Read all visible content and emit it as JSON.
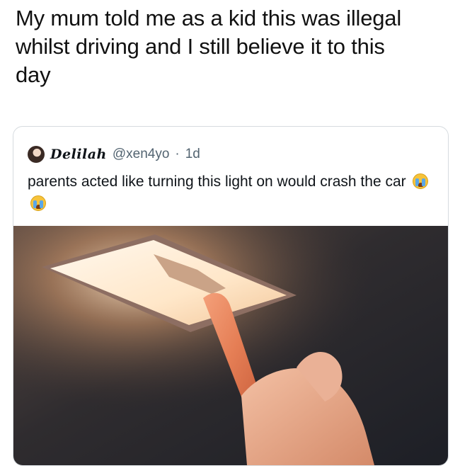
{
  "caption": {
    "line1": "My mum told me as a kid this was illegal",
    "line2": "whilst driving and I still believe it to this",
    "line3": "day"
  },
  "tweet": {
    "display_name": "Delilah",
    "handle": "@xen4yo",
    "separator": "·",
    "age": "1d",
    "text": "parents acted like turning this light on would crash the car",
    "emoji_icons": [
      "loudly-crying-face-icon",
      "loudly-crying-face-icon"
    ],
    "photo_label": "car-dome-light-photo"
  }
}
